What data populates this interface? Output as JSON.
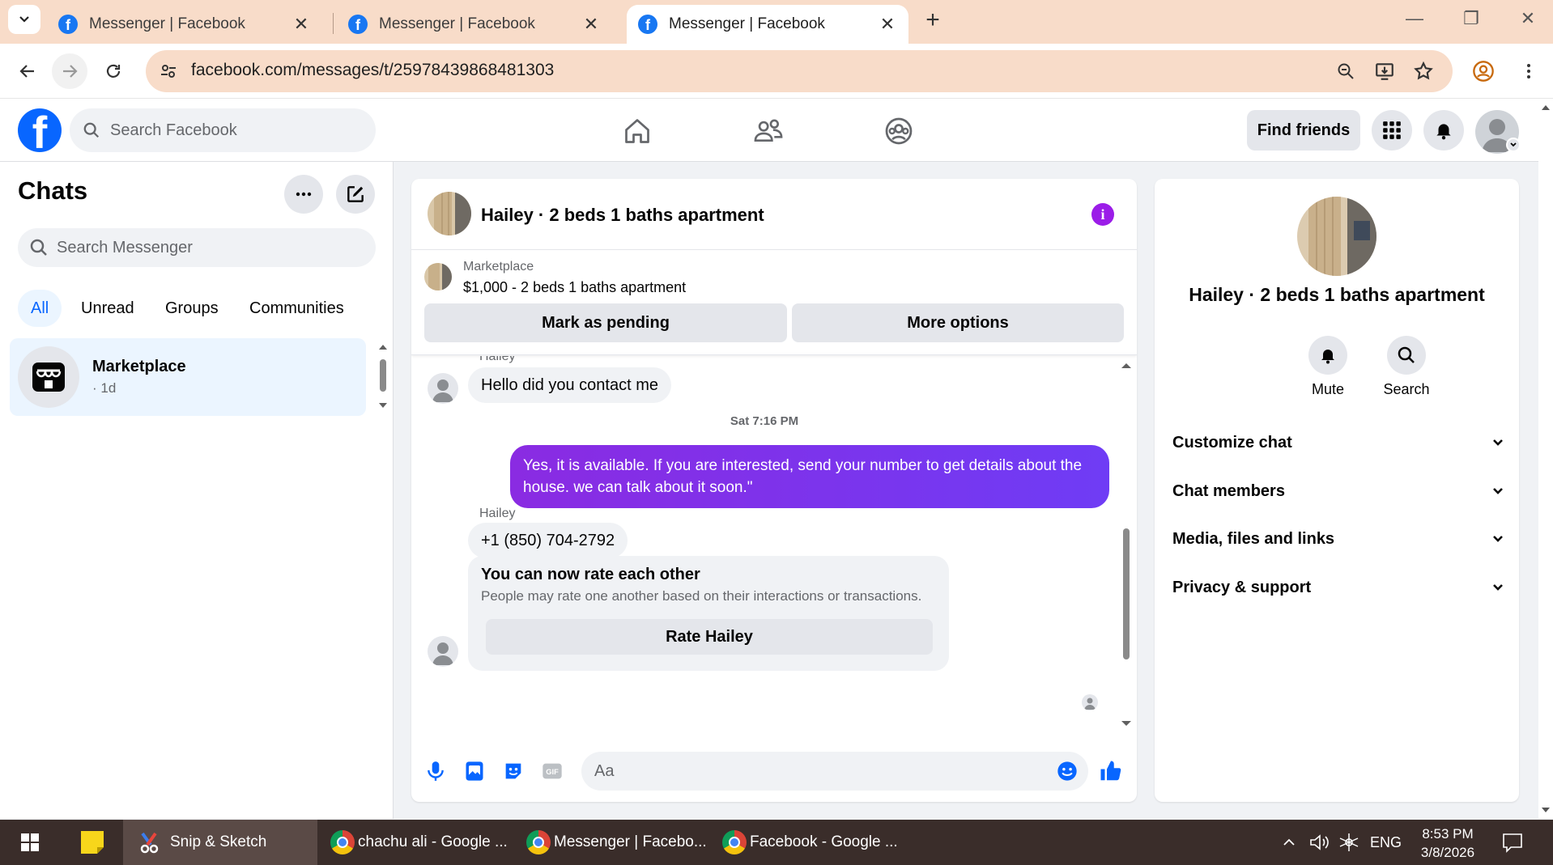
{
  "browser": {
    "tabs": [
      {
        "title": "Messenger | Facebook",
        "active": false
      },
      {
        "title": "Messenger | Facebook",
        "active": false
      },
      {
        "title": "Messenger | Facebook",
        "active": true
      }
    ],
    "url": "facebook.com/messages/t/25978439868481303"
  },
  "fb": {
    "search_placeholder": "Search Facebook",
    "find_friends": "Find friends"
  },
  "sidebar": {
    "title": "Chats",
    "search_placeholder": "Search Messenger",
    "filters": [
      "All",
      "Unread",
      "Groups",
      "Communities"
    ],
    "active_filter": "All",
    "chats": [
      {
        "name": "Marketplace",
        "time": "· 1d"
      }
    ]
  },
  "conversation": {
    "header_name": "Hailey · 2 beds 1 baths apartment",
    "listing": {
      "label": "Marketplace",
      "title": "$1,000 - 2 beds 1 baths apartment",
      "primary_button": "Mark as pending",
      "secondary_button": "More options"
    },
    "messages": {
      "top_sender": "Hailey",
      "msg1": "Hello did you contact me",
      "timestamp": "Sat 7:16 PM",
      "msg2": "Yes, it is available. If you are interested, send your number to get details about the house. we can talk about it soon.\"",
      "sender2": "Hailey",
      "msg3": "+1 (850) 704-2792",
      "rate_title": "You can now rate each other",
      "rate_desc": "People may rate one another based on their interactions or transactions.",
      "rate_button": "Rate Hailey"
    },
    "composer_placeholder": "Aa"
  },
  "info_panel": {
    "name": "Hailey · 2 beds 1 baths apartment",
    "actions": [
      "Mute",
      "Search"
    ],
    "sections": [
      "Customize chat",
      "Chat members",
      "Media, files and links",
      "Privacy & support"
    ]
  },
  "taskbar": {
    "items": [
      "Snip & Sketch",
      "chachu ali - Google ...",
      "Messenger | Facebo...",
      "Facebook - Google ..."
    ],
    "language": "ENG",
    "time": "8:53 PM",
    "date": "3/8/2026"
  },
  "colors": {
    "accent": "#0866ff",
    "outgoing_bubble": "#7b33f0",
    "info_icon": "#9b1de8",
    "tab_strip": "#f8dcc9"
  }
}
